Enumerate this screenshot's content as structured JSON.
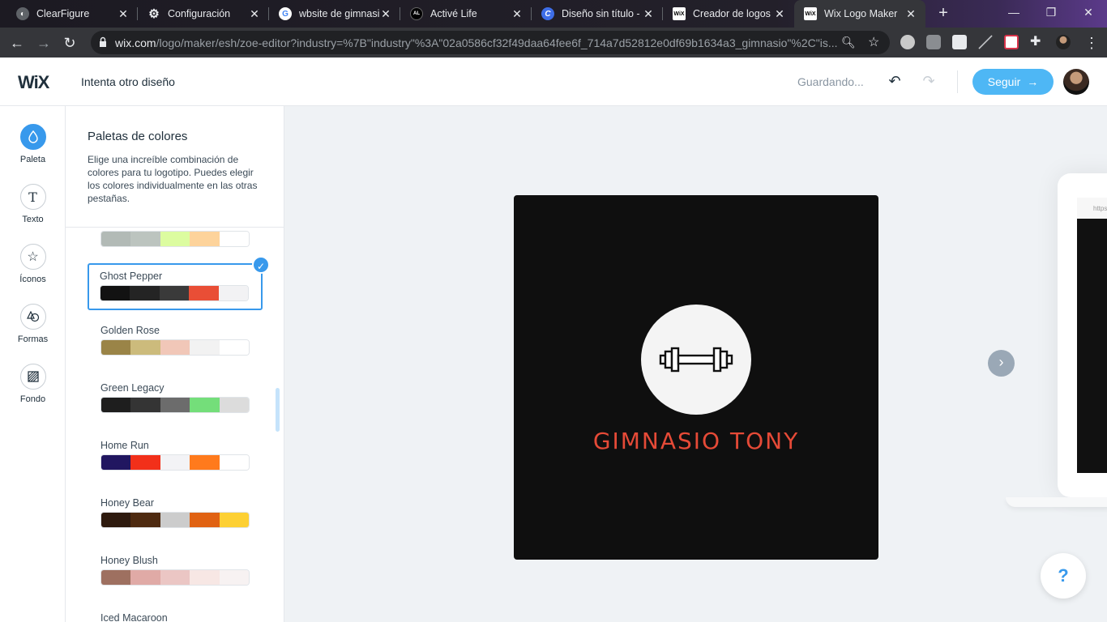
{
  "browser": {
    "tabs": [
      {
        "title": "ClearFigure",
        "icon": "clearfigure-icon",
        "color": "#5f6368"
      },
      {
        "title": "Configuración",
        "icon": "gear-icon",
        "color": "#e8eaed"
      },
      {
        "title": "wbsite de gimnasio",
        "icon": "google-icon",
        "color": "#ffffff"
      },
      {
        "title": "Activé Life",
        "icon": "activelife-icon",
        "color": "#000000"
      },
      {
        "title": "Diseño sin título -",
        "icon": "canva-icon",
        "color": "#3e6ee8"
      },
      {
        "title": "Creador de logos |",
        "icon": "wix-icon",
        "color": "#ffffff"
      },
      {
        "title": "Wix Logo Maker",
        "icon": "wix-icon",
        "color": "#ffffff"
      }
    ],
    "url_host": "wix.com",
    "url_path": "/logo/maker/esh/zoe-editor?industry=%7B\"industry\"%3A\"02a0586cf32f49daa64fee6f_714a7d52812e0df69b1634a3_gimnasio\"%2C\"is..."
  },
  "header": {
    "logo": "WiX",
    "try_other": "Intenta otro diseño",
    "saving": "Guardando...",
    "follow_label": "Seguir"
  },
  "rail": [
    {
      "label": "Paleta",
      "icon": "drop-icon",
      "active": true
    },
    {
      "label": "Texto",
      "icon": "text-icon",
      "active": false
    },
    {
      "label": "Íconos",
      "icon": "star-icon",
      "active": false
    },
    {
      "label": "Formas",
      "icon": "shapes-icon",
      "active": false
    },
    {
      "label": "Fondo",
      "icon": "background-icon",
      "active": false
    }
  ],
  "panel": {
    "title": "Paletas de colores",
    "description": "Elige una increíble combinación de colores para tu logotipo. Puedes elegir los colores individualmente en las otras pestañas.",
    "palettes": [
      {
        "name": "",
        "colors": [
          "#b2bab6",
          "#bcc4bf",
          "#dcfca0",
          "#fdd39b",
          "#ffffff"
        ]
      },
      {
        "name": "Ghost Pepper",
        "colors": [
          "#121212",
          "#242424",
          "#3a3a3a",
          "#e94e36",
          "#f2f2f4"
        ],
        "selected": true
      },
      {
        "name": "Golden Rose",
        "colors": [
          "#9a8447",
          "#ccbb7c",
          "#f1c7b8",
          "#f2f2f2",
          "#ffffff"
        ]
      },
      {
        "name": "Green Legacy",
        "colors": [
          "#1e1e1e",
          "#343434",
          "#6c6c6c",
          "#74de7a",
          "#dcdcdc"
        ]
      },
      {
        "name": "Home Run",
        "colors": [
          "#211660",
          "#f2301a",
          "#f3f3f6",
          "#ff7a1c",
          "#ffffff"
        ]
      },
      {
        "name": "Honey Bear",
        "colors": [
          "#2e1a0e",
          "#4e2a10",
          "#cccccc",
          "#e06212",
          "#fdd033"
        ]
      },
      {
        "name": "Honey Blush",
        "colors": [
          "#9e7060",
          "#e0aaa6",
          "#ebc6c4",
          "#f7e7e4",
          "#f7f2f2"
        ]
      },
      {
        "name": "Iced Macaroon",
        "colors": []
      }
    ]
  },
  "canvas": {
    "brand_name": "GIMNASIO TONY",
    "logo_bg": "#0f0f0f",
    "accent": "#e54a37",
    "device_url_fragment": "https:"
  },
  "help": "?"
}
